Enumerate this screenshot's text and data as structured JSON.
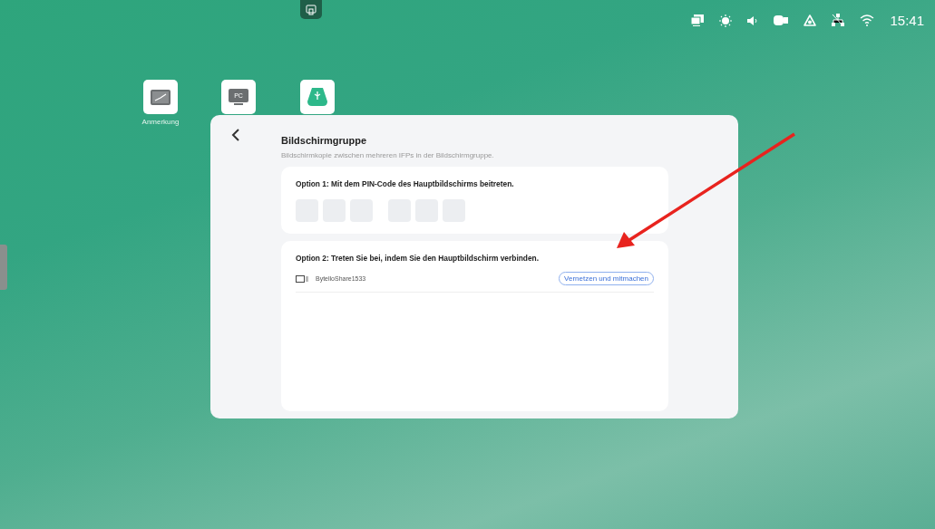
{
  "status_bar": {
    "time": "15:41"
  },
  "desktop_icons": [
    {
      "kind": "annotation",
      "label": "Anmerkung"
    },
    {
      "kind": "pc",
      "badge": "PC"
    },
    {
      "kind": "usb"
    }
  ],
  "dialog": {
    "title": "Bildschirmgruppe",
    "subtitle": "Bildschirmkopie zwischen mehreren IFPs in der Bildschirmgruppe.",
    "option_1": {
      "title": "Option 1: Mit dem PIN-Code des Hauptbildschirms beitreten.",
      "pin_boxes": [
        {
          "filled": false
        },
        {
          "filled": false
        },
        {
          "filled": false
        },
        {
          "filled": false
        },
        {
          "filled": false
        },
        {
          "filled": false
        }
      ]
    },
    "option_2": {
      "title": "Option 2: Treten Sie bei, indem Sie den Hauptbildschirm verbinden.",
      "devices": [
        {
          "name": "BytelloShare1533",
          "action": "Vernetzen und mitmachen"
        }
      ]
    }
  }
}
